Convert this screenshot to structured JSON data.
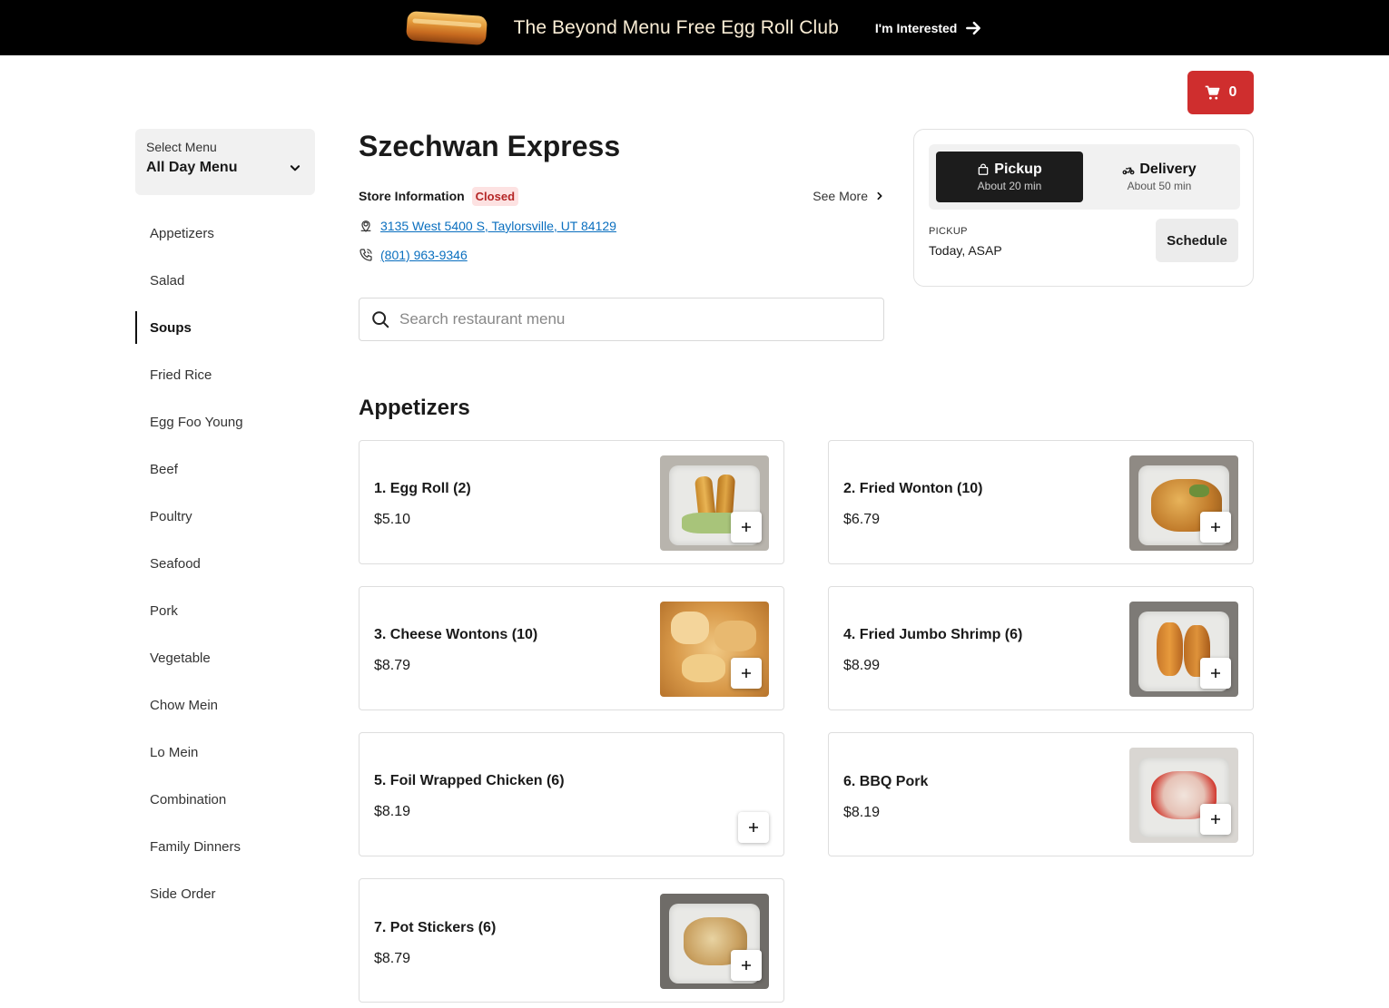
{
  "promo": {
    "title": "The Beyond Menu Free Egg Roll Club",
    "cta": "I'm Interested"
  },
  "cart": {
    "count": "0"
  },
  "menu_select": {
    "label": "Select Menu",
    "value": "All Day Menu"
  },
  "categories": [
    {
      "label": "Appetizers",
      "active": false
    },
    {
      "label": "Salad",
      "active": false
    },
    {
      "label": "Soups",
      "active": true
    },
    {
      "label": "Fried Rice",
      "active": false
    },
    {
      "label": "Egg Foo Young",
      "active": false
    },
    {
      "label": "Beef",
      "active": false
    },
    {
      "label": "Poultry",
      "active": false
    },
    {
      "label": "Seafood",
      "active": false
    },
    {
      "label": "Pork",
      "active": false
    },
    {
      "label": "Vegetable",
      "active": false
    },
    {
      "label": "Chow Mein",
      "active": false
    },
    {
      "label": "Lo Mein",
      "active": false
    },
    {
      "label": "Combination",
      "active": false
    },
    {
      "label": "Family Dinners",
      "active": false
    },
    {
      "label": "Side Order",
      "active": false
    }
  ],
  "store": {
    "name": "Szechwan Express",
    "info_label": "Store Information",
    "status": "Closed",
    "see_more": "See More",
    "address": "3135 West 5400 S, Taylorsville, UT 84129",
    "phone": "(801) 963-9346"
  },
  "search": {
    "placeholder": "Search restaurant menu"
  },
  "order": {
    "pickup_label": "Pickup",
    "pickup_eta": "About 20 min",
    "delivery_label": "Delivery",
    "delivery_eta": "About 50 min",
    "mode_heading": "PICKUP",
    "time": "Today, ASAP",
    "schedule": "Schedule"
  },
  "section": {
    "title": "Appetizers",
    "items": [
      {
        "name": "1. Egg Roll (2)",
        "price": "$5.10",
        "has_image": true
      },
      {
        "name": "2. Fried Wonton (10)",
        "price": "$6.79",
        "has_image": true
      },
      {
        "name": "3. Cheese Wontons (10)",
        "price": "$8.79",
        "has_image": true
      },
      {
        "name": "4. Fried Jumbo Shrimp (6)",
        "price": "$8.99",
        "has_image": true
      },
      {
        "name": "5. Foil Wrapped Chicken (6)",
        "price": "$8.19",
        "has_image": false
      },
      {
        "name": "6. BBQ Pork",
        "price": "$8.19",
        "has_image": true
      },
      {
        "name": "7. Pot Stickers (6)",
        "price": "$8.79",
        "has_image": true
      }
    ]
  },
  "colors": {
    "banner_bg": "#000000",
    "cart_red": "#cf2e2e",
    "link_blue": "#0a6fbf",
    "closed_bg": "#fde2e2",
    "closed_text": "#b52626",
    "pickup_active": "#1c1c1c"
  }
}
